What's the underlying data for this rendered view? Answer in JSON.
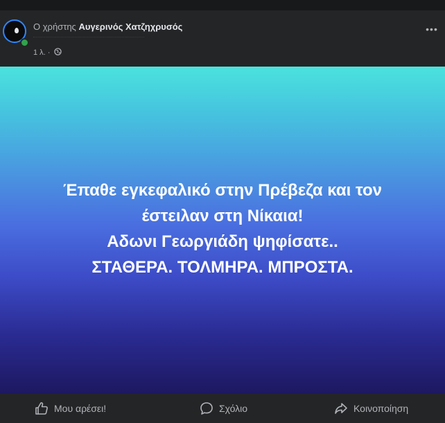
{
  "post": {
    "author_prefix": "Ο χρήστης",
    "author_name": "Αυγερινός Χατζηχρυσός",
    "time": "1 λ. ·",
    "more_label": "•••",
    "image_lines": [
      "Έπαθε εγκεφαλικό στην Πρέβεζα και τον",
      "έστειλαν στη Νίκαια!",
      "Αδωνι Γεωργιάδη ψηφίσατε..",
      "ΣΤΑΘΕΡΑ. ΤΟΛΜΗΡΑ. ΜΠΡΟΣΤΑ."
    ]
  },
  "actions": {
    "like": "Μου αρέσει!",
    "comment": "Σχόλιο",
    "share": "Κοινοποίηση"
  },
  "icons": {
    "avatar": "drop-avatar-icon",
    "privacy": "globe-icon",
    "like": "thumbs-up-icon",
    "comment": "speech-bubble-icon",
    "share": "share-arrow-icon"
  },
  "colors": {
    "card_background": "#242526",
    "text_primary": "#e4e6eb",
    "text_secondary": "#b0b3b8",
    "online_status": "#31a24c",
    "image_gradient_top": "#4ae2de",
    "image_gradient_bottom": "#1d1860"
  }
}
